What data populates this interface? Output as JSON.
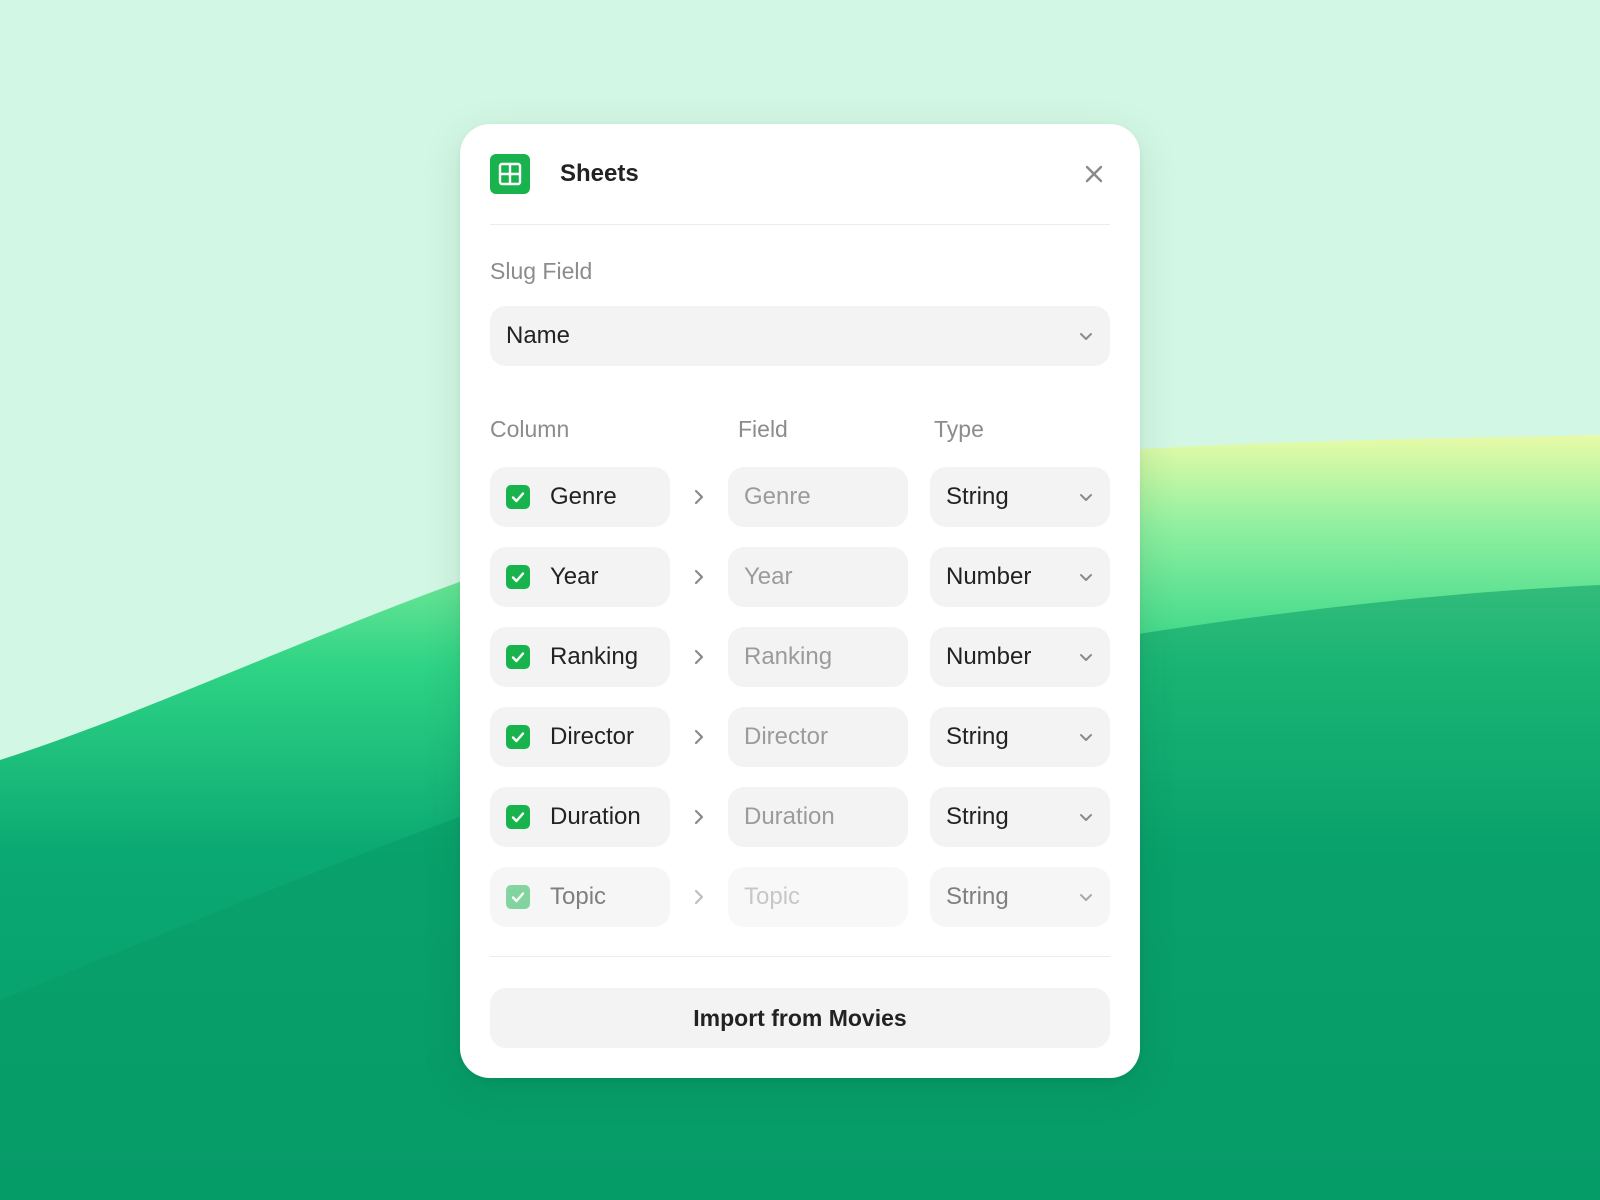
{
  "colors": {
    "accent": "#19b34d",
    "background_top": "#d3f7e5",
    "background_green": "#0a9e67"
  },
  "header": {
    "app_icon": "grid-icon",
    "title": "Sheets",
    "close_icon": "close-icon"
  },
  "slug": {
    "label": "Slug Field",
    "value": "Name"
  },
  "table": {
    "headers": {
      "column": "Column",
      "field": "Field",
      "type": "Type"
    },
    "rows": [
      {
        "column": "Genre",
        "checked": true,
        "field_placeholder": "Genre",
        "type": "String"
      },
      {
        "column": "Year",
        "checked": true,
        "field_placeholder": "Year",
        "type": "Number"
      },
      {
        "column": "Ranking",
        "checked": true,
        "field_placeholder": "Ranking",
        "type": "Number"
      },
      {
        "column": "Director",
        "checked": true,
        "field_placeholder": "Director",
        "type": "String"
      },
      {
        "column": "Duration",
        "checked": true,
        "field_placeholder": "Duration",
        "type": "String"
      },
      {
        "column": "Topic",
        "checked": true,
        "field_placeholder": "Topic",
        "type": "String"
      }
    ]
  },
  "footer": {
    "import_label": "Import from Movies"
  }
}
